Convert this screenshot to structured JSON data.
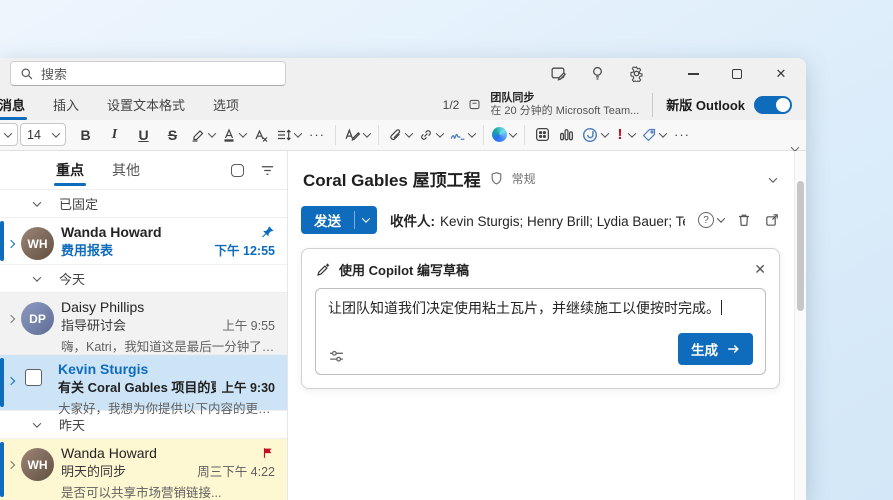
{
  "colors": {
    "accent": "#0f6cbd",
    "selected_row": "#cde4f7",
    "flagged_row": "#fdf7d2",
    "importance_red": "#c50f1f"
  },
  "titlebar": {
    "search_placeholder": "搜索"
  },
  "ribbon": {
    "tabs": [
      {
        "label": "消息"
      },
      {
        "label": "插入"
      },
      {
        "label": "设置文本格式"
      },
      {
        "label": "选项"
      }
    ],
    "pager": "1/2",
    "meeting": {
      "title": "团队同步",
      "subtitle": "在 20 分钟的 Microsoft Team..."
    },
    "new_outlook_label": "新版 Outlook",
    "toggle_state": "on"
  },
  "toolbar": {
    "font_size": "14",
    "bold": "B",
    "italic": "I",
    "underline": "U",
    "strikethrough": "S",
    "more": "···",
    "importance": "!"
  },
  "mail": {
    "tabs": [
      {
        "label": "重点"
      },
      {
        "label": "其他"
      }
    ],
    "groups": [
      {
        "header": "已固定",
        "emails": [
          {
            "sender": "Wanda Howard",
            "subject": "费用报表",
            "time": "下午 12:55",
            "initials": "WH",
            "pinned": "true",
            "unread": "true"
          }
        ]
      },
      {
        "header": "今天",
        "emails": [
          {
            "sender": "Daisy Phillips",
            "subject": "指导研讨会",
            "time": "上午 9:55",
            "preview": "嗨，Katri，我知道这是最后一分钟了，但...",
            "initials": "DP"
          },
          {
            "sender": "Kevin Sturgis",
            "subject": "有关 Coral Gables 项目的更新",
            "time": "上午 9:30",
            "preview": "大家好，我想为你提供以下内容的更新...",
            "selected": "true",
            "unread": "true"
          }
        ]
      },
      {
        "header": "昨天",
        "emails": [
          {
            "sender": "Wanda Howard",
            "subject": "明天的同步",
            "time": "周三下午 4:22",
            "preview": "是否可以共享市场营销链接...",
            "initials": "WH",
            "flagged": "true"
          }
        ]
      }
    ]
  },
  "compose": {
    "title": "Coral Gables 屋顶工程",
    "sensitivity": "常规",
    "send_label": "发送",
    "to_label": "收件人:",
    "recipients": "Kevin Sturgis; Henry Brill; Lydia Bauer; Tenzin Lasya"
  },
  "copilot": {
    "title": "使用 Copilot 编写草稿",
    "prompt": "让团队知道我们决定使用粘土瓦片，并继续施工以便按时完成。",
    "generate_label": "生成"
  }
}
